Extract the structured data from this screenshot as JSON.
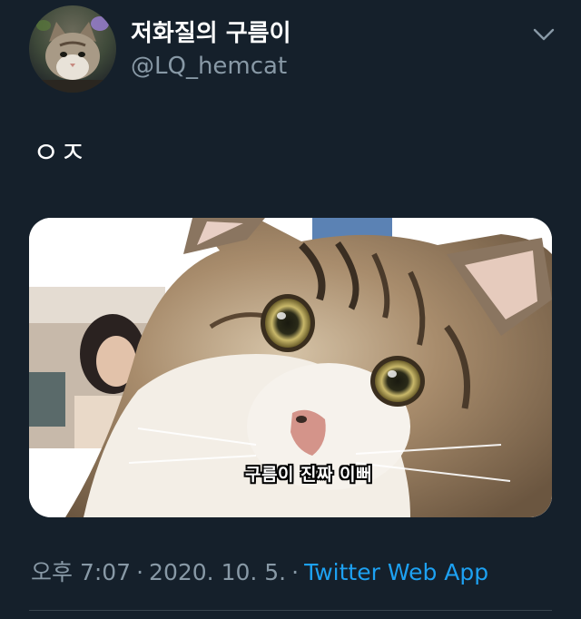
{
  "tweet": {
    "display_name": "저화질의 구름이",
    "handle": "@LQ_hemcat",
    "text": "ㅇㅈ",
    "media_caption": "구름이 진짜 이뻐",
    "time": "오후 7:07",
    "date": "2020. 10. 5.",
    "separator": "·",
    "source": "Twitter Web App"
  },
  "icons": {
    "more": "chevron-down-icon"
  },
  "colors": {
    "background": "#15202b",
    "primary_text": "#ffffff",
    "secondary_text": "#8899a6",
    "link": "#1da1f2"
  }
}
